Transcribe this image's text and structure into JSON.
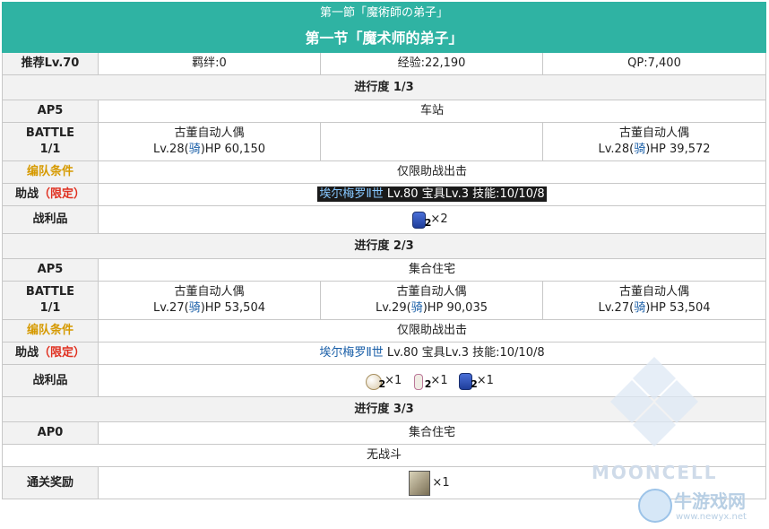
{
  "header": {
    "jp_title": "第一節「魔術師の弟子」",
    "cn_title": "第一节「魔术师的弟子」"
  },
  "summary": {
    "rec_level": "推荐Lv.70",
    "bond": "羁绊:0",
    "exp": "经验:22,190",
    "qp": "QP:7,400"
  },
  "labels": {
    "battle": "BATTLE",
    "formation": "编队条件",
    "support_prefix": "助战",
    "support_limited": "（限定）",
    "drops": "战利品"
  },
  "sections": [
    {
      "title": "进行度 1/3",
      "ap": "AP5",
      "location": "车站",
      "wave": "1/1",
      "enemies": [
        {
          "name": "古董自动人偶",
          "level": "Lv.28(",
          "cls": "骑",
          "hp": ")HP 60,150"
        },
        {
          "name": "",
          "level": "",
          "cls": "",
          "hp": ""
        },
        {
          "name": "古董自动人偶",
          "level": "Lv.28(",
          "cls": "骑",
          "hp": ")HP 39,572"
        }
      ],
      "formation_text": "仅限助战出击",
      "support": {
        "servant": "埃尔梅罗Ⅱ世",
        "detail": " Lv.80 宝具Lv.3 技能:10/10/8"
      },
      "drops": [
        {
          "icon": "blue-gem-icon",
          "sub": "2",
          "count": "×2"
        }
      ]
    },
    {
      "title": "进行度 2/3",
      "ap": "AP5",
      "location": "集合住宅",
      "wave": "1/1",
      "enemies": [
        {
          "name": "古董自动人偶",
          "level": "Lv.27(",
          "cls": "骑",
          "hp": ")HP 53,504"
        },
        {
          "name": "古董自动人偶",
          "level": "Lv.29(",
          "cls": "骑",
          "hp": ")HP 90,035"
        },
        {
          "name": "古董自动人偶",
          "level": "Lv.27(",
          "cls": "骑",
          "hp": ")HP 53,504"
        }
      ],
      "formation_text": "仅限助战出击",
      "support": {
        "servant": "埃尔梅罗Ⅱ世",
        "detail": " Lv.80 宝具Lv.3 技能:10/10/8"
      },
      "drops": [
        {
          "icon": "orb-icon",
          "sub": "2",
          "count": "×1"
        },
        {
          "icon": "bone-icon",
          "sub": "2",
          "count": "×1"
        },
        {
          "icon": "blue-gem-icon",
          "sub": "2",
          "count": "×1"
        }
      ]
    },
    {
      "title": "进行度 3/3",
      "ap": "AP0",
      "location": "集合住宅",
      "no_battle": "无战斗",
      "reward_label": "通关奖励",
      "reward_count": "×1"
    }
  ],
  "watermarks": {
    "mooncell": "MOONCELL",
    "site_cn": "牛游戏网",
    "site_url": "www.newyx.net"
  }
}
